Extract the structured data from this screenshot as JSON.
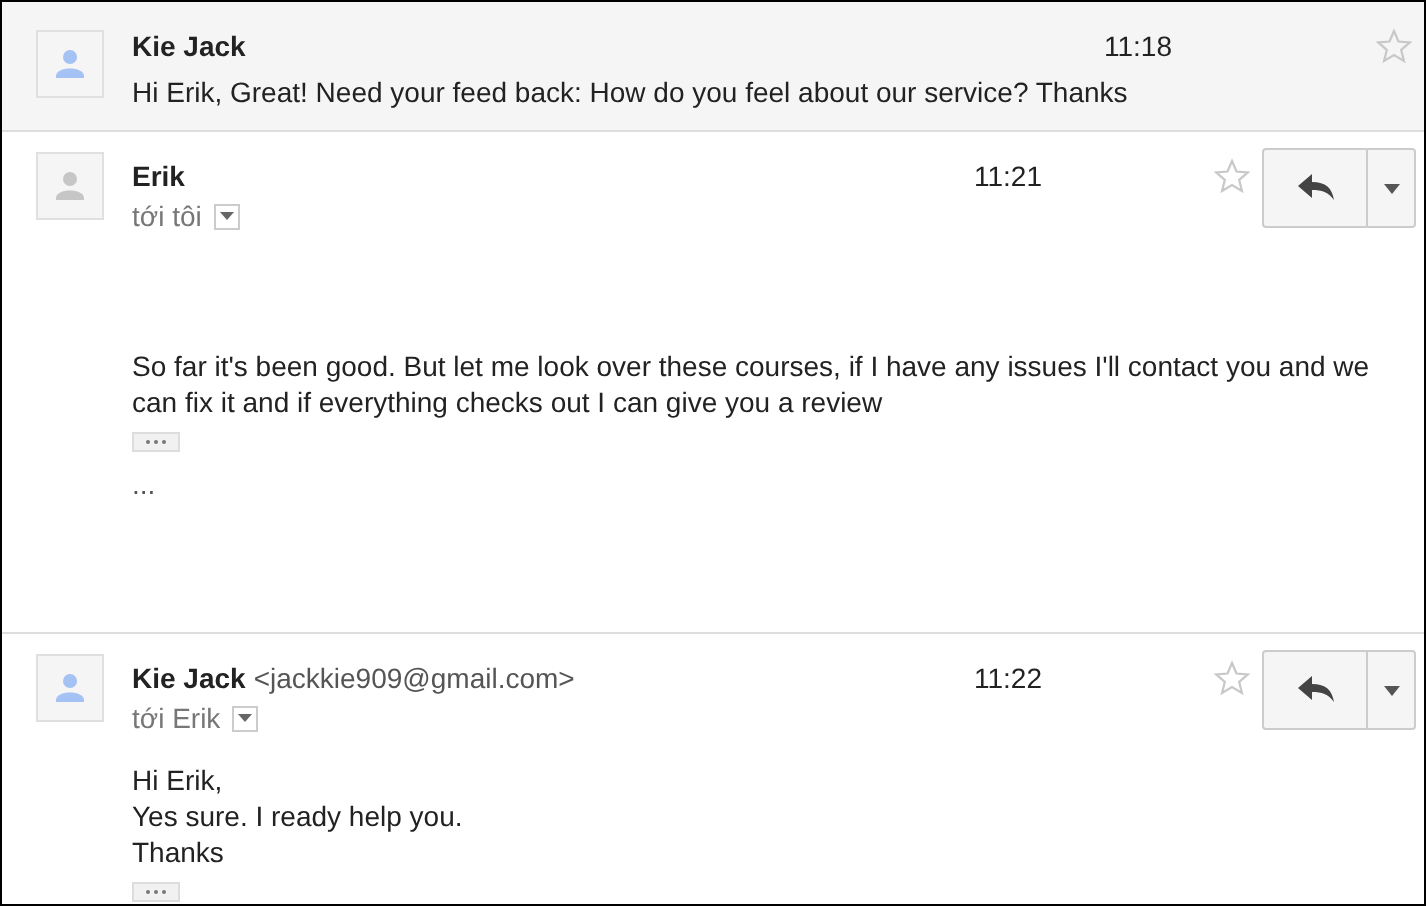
{
  "messages": [
    {
      "sender": "Kie Jack",
      "time": "11:18",
      "color": "#a4c2f4",
      "expanded": false,
      "starred": false,
      "snippet": "Hi Erik, Great! Need your feed back: How do you feel about our service? Thanks"
    },
    {
      "sender": "Erik",
      "time": "11:21",
      "color": "#c6c6c6",
      "expanded": true,
      "starred": false,
      "recipient": "tới tôi",
      "body": [
        "So far it's been good. But let me look over these courses, if I have any issues I'll contact you and we can fix it and if everything checks out I can give you a review"
      ],
      "quote": "..."
    },
    {
      "sender": "Kie Jack",
      "sender_email": "<jackkie909@gmail.com>",
      "time": "11:22",
      "color": "#a4c2f4",
      "expanded": true,
      "starred": false,
      "recipient": "tới Erik",
      "body": [
        "Hi Erik,",
        "Yes sure. I ready help you.",
        "Thanks"
      ]
    }
  ]
}
